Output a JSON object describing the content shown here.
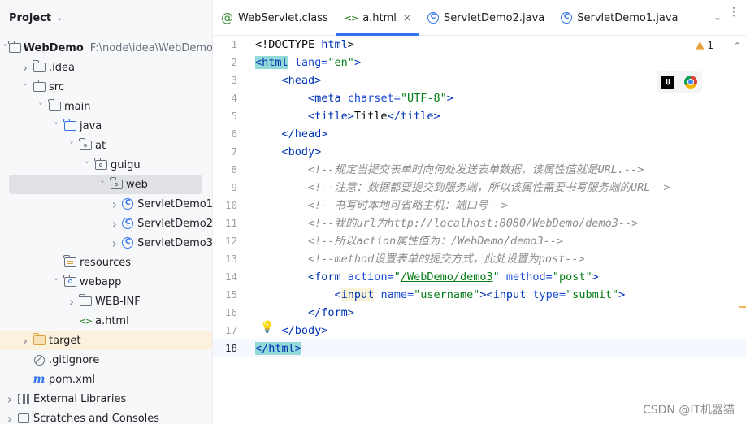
{
  "project_panel": {
    "title": "Project",
    "tree": [
      {
        "label": "WebDemo",
        "path": "F:\\node\\idea\\WebDemo",
        "icon": "module-folder-icon",
        "arrow": "down",
        "indent": 0,
        "bold": true
      },
      {
        "label": ".idea",
        "icon": "folder-icon",
        "arrow": "right",
        "indent": 1
      },
      {
        "label": "src",
        "icon": "folder-icon",
        "arrow": "down",
        "indent": 1
      },
      {
        "label": "main",
        "icon": "folder-icon",
        "arrow": "down",
        "indent": 2
      },
      {
        "label": "java",
        "icon": "source-folder-icon",
        "arrow": "down",
        "indent": 3
      },
      {
        "label": "at",
        "icon": "package-icon",
        "arrow": "down",
        "indent": 4
      },
      {
        "label": "guigu",
        "icon": "package-icon",
        "arrow": "down",
        "indent": 5
      },
      {
        "label": "web",
        "icon": "package-icon",
        "arrow": "down",
        "indent": 6,
        "selected": true
      },
      {
        "label": "ServletDemo1",
        "icon": "class-icon",
        "arrow": "right",
        "indent": 7
      },
      {
        "label": "ServletDemo2",
        "icon": "class-icon",
        "arrow": "right",
        "indent": 7
      },
      {
        "label": "ServletDemo3",
        "icon": "class-icon",
        "arrow": "right",
        "indent": 7
      },
      {
        "label": "resources",
        "icon": "resources-folder-icon",
        "arrow": "none",
        "indent": 3
      },
      {
        "label": "webapp",
        "icon": "web-folder-icon",
        "arrow": "down",
        "indent": 3
      },
      {
        "label": "WEB-INF",
        "icon": "folder-icon",
        "arrow": "right",
        "indent": 4
      },
      {
        "label": "a.html",
        "icon": "html-file-icon",
        "arrow": "none",
        "indent": 4
      },
      {
        "label": "target",
        "icon": "excluded-folder-icon",
        "arrow": "right",
        "indent": 1,
        "highlight": true
      },
      {
        "label": ".gitignore",
        "icon": "gitignore-icon",
        "arrow": "none",
        "indent": 1
      },
      {
        "label": "pom.xml",
        "icon": "maven-icon",
        "arrow": "none",
        "indent": 1
      },
      {
        "label": "External Libraries",
        "icon": "library-icon",
        "arrow": "right",
        "indent": 0
      },
      {
        "label": "Scratches and Consoles",
        "icon": "scratch-icon",
        "arrow": "right",
        "indent": 0
      }
    ]
  },
  "tabs": [
    {
      "label": "WebServlet.class",
      "icon": "annotation-icon",
      "active": false
    },
    {
      "label": "a.html",
      "icon": "html-file-icon",
      "active": true,
      "closable": true
    },
    {
      "label": "ServletDemo2.java",
      "icon": "class-icon",
      "active": false
    },
    {
      "label": "ServletDemo1.java",
      "icon": "class-icon",
      "active": false
    }
  ],
  "editor": {
    "warning_count": "1",
    "current_line": 18,
    "lines": [
      [
        {
          "t": "<!DOCTYPE ",
          "c": "txt"
        },
        {
          "t": "html",
          "c": "tag"
        },
        {
          "t": ">",
          "c": "txt"
        }
      ],
      [
        {
          "t": "<html",
          "c": "tag",
          "hl": "match"
        },
        {
          "t": " lang=",
          "c": "attr"
        },
        {
          "t": "\"en\"",
          "c": "val"
        },
        {
          "t": ">",
          "c": "tag"
        }
      ],
      [
        {
          "t": "    <head>",
          "c": "tag"
        }
      ],
      [
        {
          "t": "        <meta",
          "c": "tag"
        },
        {
          "t": " charset=",
          "c": "attr"
        },
        {
          "t": "\"UTF-8\"",
          "c": "val"
        },
        {
          "t": ">",
          "c": "tag"
        }
      ],
      [
        {
          "t": "        <title>",
          "c": "tag"
        },
        {
          "t": "Title",
          "c": "txt"
        },
        {
          "t": "</title>",
          "c": "tag"
        }
      ],
      [
        {
          "t": "    </head>",
          "c": "tag"
        }
      ],
      [
        {
          "t": "    <body>",
          "c": "tag"
        }
      ],
      [
        {
          "t": "        <!--规定当提交表单时向何处发送表单数据，该属性值就是URL.-->",
          "c": "cmt"
        }
      ],
      [
        {
          "t": "        <!--注意：数据都要提交到服务端，所以该属性需要书写服务端的URL-->",
          "c": "cmt"
        }
      ],
      [
        {
          "t": "        <!--书写时本地可省略主机：端口号-->",
          "c": "cmt"
        }
      ],
      [
        {
          "t": "        <!--我的url为http://localhost:8080/WebDemo/demo3-->",
          "c": "cmt"
        }
      ],
      [
        {
          "t": "        <!--所以action属性值为：/WebDemo/demo3-->",
          "c": "cmt"
        }
      ],
      [
        {
          "t": "        <!--method设置表单的提交方式，此处设置为post-->",
          "c": "cmt"
        }
      ],
      [
        {
          "t": "        <form",
          "c": "tag"
        },
        {
          "t": " action=",
          "c": "attr"
        },
        {
          "t": "\"",
          "c": "val"
        },
        {
          "t": "/WebDemo/demo3",
          "c": "link"
        },
        {
          "t": "\"",
          "c": "val"
        },
        {
          "t": " method=",
          "c": "attr"
        },
        {
          "t": "\"post\"",
          "c": "val"
        },
        {
          "t": ">",
          "c": "tag"
        }
      ],
      [
        {
          "t": "            <",
          "c": "tag"
        },
        {
          "t": "input",
          "c": "tag",
          "hl": "input"
        },
        {
          "t": " name=",
          "c": "attr"
        },
        {
          "t": "\"username\"",
          "c": "val"
        },
        {
          "t": "><input",
          "c": "tag"
        },
        {
          "t": " type=",
          "c": "attr"
        },
        {
          "t": "\"submit\"",
          "c": "val"
        },
        {
          "t": ">",
          "c": "tag"
        }
      ],
      [
        {
          "t": "        </form>",
          "c": "tag"
        }
      ],
      [
        {
          "t": "    </body>",
          "c": "tag"
        }
      ],
      [
        {
          "t": "</html>",
          "c": "tag",
          "hl": "match"
        }
      ]
    ]
  },
  "watermark": "CSDN @IT机器猫"
}
